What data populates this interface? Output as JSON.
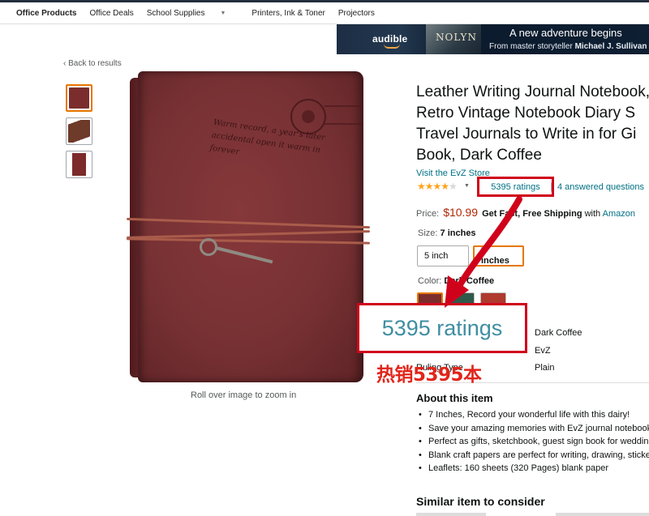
{
  "nav": {
    "items": [
      "Office Products",
      "Office Deals",
      "School Supplies",
      "Printers, Ink & Toner",
      "Projectors"
    ]
  },
  "ad": {
    "brand": "audible",
    "book_title": "NOLYN",
    "headline": "A new adventure begins",
    "sub_prefix": "From master storyteller ",
    "sub_author": "Michael J. Sullivan"
  },
  "gallery": {
    "back_link": "‹ Back to results",
    "caption": "Roll over image to zoom in",
    "journal_inscription": "Warm record, a year's later accidental open it warm in forever"
  },
  "product": {
    "title_lines": [
      "Leather Writing Journal Notebook,",
      "Retro Vintage Notebook Diary S",
      "Travel Journals to Write in for Gi",
      "Book, Dark Coffee"
    ],
    "store_link": "Visit the EvZ Store",
    "stars": "★★★★",
    "star_half": "★",
    "ratings": "5395 ratings",
    "answered": "4 answered questions",
    "price_label": "Price:",
    "price": "$10.99",
    "shipping": "Get Fast, Free Shipping",
    "shipping_with": " with ",
    "shipping_link": "Amazon",
    "size_label": "Size:",
    "size_value": "7 inches",
    "size_options": [
      "5 inch",
      "7 inches"
    ],
    "color_label": "Color:",
    "color_value": "Dark Coffee",
    "color_swatches": [
      "#7b2d2d",
      "#2f5a4a",
      "#b03a2e"
    ],
    "specs": {
      "color": "Dark Coffee",
      "brand": "EvZ",
      "ruling_key": "Ruling Type",
      "ruling": "Plain"
    },
    "about_heading": "About this item",
    "bullets": [
      "7 Inches, Record your wonderful life with this dairy!",
      "Save your amazing memories with EvZ journal notebook",
      "Perfect as gifts, sketchbook, guest sign book for wedding",
      "Blank craft papers are perfect for writing, drawing, stickers",
      "Leaflets: 160 sheets (320 Pages) blank paper"
    ],
    "similar_heading": "Similar item to consider"
  },
  "annotation": {
    "callout_text": "5395 ratings",
    "cn_label": "热销5395本",
    "color": "#d0021b"
  }
}
